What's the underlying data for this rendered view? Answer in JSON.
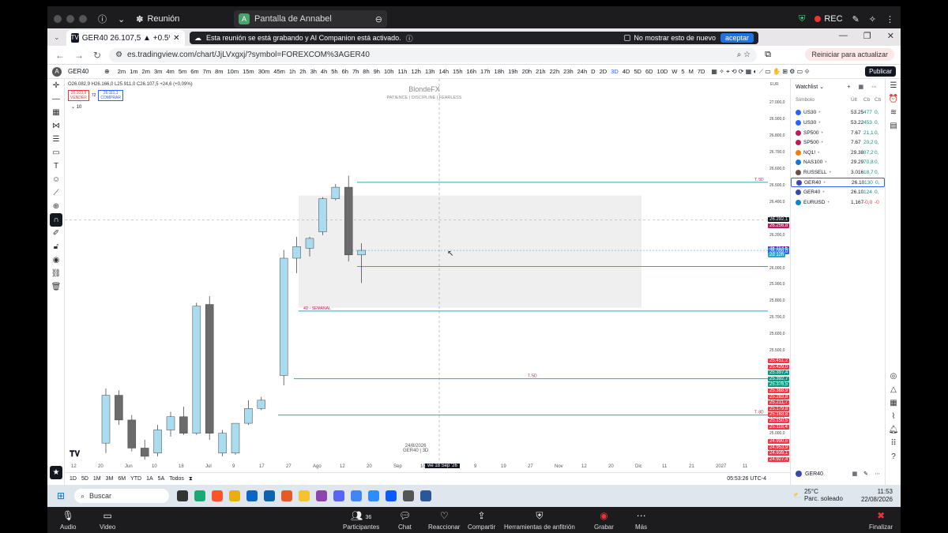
{
  "zoom_top": {
    "meeting_label": "Reunión",
    "share_label": "Pantalla de Annabel",
    "share_avatar": "A",
    "rec_label": "REC"
  },
  "browser": {
    "tab_title": "GER40 26.107,5 ▲ +0.5% Anna...",
    "new_tab": "+",
    "url": "es.tradingview.com/chart/JjLVxgxj/?symbol=FOREXCOM%3AGER40",
    "restart_label": "Reiniciar para actualizar",
    "avatar": "A",
    "win_min": "—",
    "win_max": "❐",
    "win_close": "✕"
  },
  "banner": {
    "text": "Esta reunión se está grabando y AI Companion está activado.",
    "checkbox_label": "No mostrar esto de nuevo",
    "accept_label": "aceptar"
  },
  "tv_top": {
    "symbol": "GER40",
    "timeframes": [
      "2m",
      "1m",
      "2m",
      "3m",
      "4m",
      "5m",
      "6m",
      "7m",
      "8m",
      "10m",
      "15m",
      "30m",
      "45m",
      "1h",
      "2h",
      "3h",
      "4h",
      "5h",
      "6h",
      "7h",
      "8h",
      "9h",
      "10h",
      "11h",
      "12h",
      "13h",
      "14h",
      "15h",
      "16h",
      "17h",
      "18h",
      "19h",
      "20h",
      "21h",
      "22h",
      "23h",
      "24h",
      "D",
      "2D",
      "3D",
      "4D",
      "5D",
      "6D",
      "10D",
      "W",
      "5",
      "M",
      "7D"
    ],
    "active_tf": "3D",
    "publish_label": "Publicar"
  },
  "chart_header": {
    "ohlc": "O26.082,9 H26.166,0 L25.911,0 C26.107,5 +24,6 (+0,09%)",
    "sell_price": "26.103,9",
    "sell_label": "VENDER",
    "spread": "72",
    "buy_price": "26.111,1",
    "buy_label": "COMPRAR",
    "volume_label": "10",
    "watermark_title": "BlondeFX",
    "watermark_sub": "PATIENCE  |  DISCIPLINE  |  FEARLESS",
    "footer_date": "24/8/2026",
    "footer_symbol": "GER40 | 3D"
  },
  "chart_data": {
    "type": "candlestick",
    "title": "",
    "x_ticks": [
      "12",
      "20",
      "Jun",
      "10",
      "18",
      "Jul",
      "9",
      "17",
      "27",
      "Ago",
      "12",
      "20",
      "Sep",
      "10",
      "Oct",
      "9",
      "19",
      "27",
      "Nov",
      "12",
      "20",
      "Dic",
      "11",
      "21",
      "2027",
      "11"
    ],
    "crosshair_x_label": "vie 18 Sep '26",
    "y_ticks": [
      "27.000,0",
      "26.900,0",
      "26.800,0",
      "26.700,0",
      "26.600,0",
      "26.500,0",
      "26.400,0",
      "26.300,0",
      "26.200,0",
      "26.100,0",
      "26.000,0",
      "25.900,0",
      "25.800,0",
      "25.700,0",
      "25.600,0",
      "25.500,0",
      "25.400,0",
      "25.300,0",
      "25.200,0",
      "25.100,0",
      "25.000,0",
      "24.900,0"
    ],
    "y_unit": "EUR",
    "ylim": [
      24850,
      27050
    ],
    "candles": [
      {
        "o": 24940,
        "h": 25270,
        "l": 24880,
        "c": 25230
      },
      {
        "o": 25230,
        "h": 25260,
        "l": 25050,
        "c": 25080
      },
      {
        "o": 25080,
        "h": 25110,
        "l": 24890,
        "c": 24910
      },
      {
        "o": 24910,
        "h": 24960,
        "l": 24840,
        "c": 24860
      },
      {
        "o": 24880,
        "h": 25050,
        "l": 24860,
        "c": 25020
      },
      {
        "o": 25020,
        "h": 25130,
        "l": 24980,
        "c": 25100
      },
      {
        "o": 25100,
        "h": 25160,
        "l": 24990,
        "c": 25000
      },
      {
        "o": 25000,
        "h": 25790,
        "l": 24990,
        "c": 25770
      },
      {
        "o": 25780,
        "h": 25830,
        "l": 24960,
        "c": 25000
      },
      {
        "o": 24880,
        "h": 25020,
        "l": 24860,
        "c": 25000
      },
      {
        "o": 24880,
        "h": 25060,
        "l": 24870,
        "c": 25060
      },
      {
        "o": 25060,
        "h": 25200,
        "l": 25050,
        "c": 25150
      },
      {
        "o": 25150,
        "h": 25220,
        "l": 25140,
        "c": 25200
      },
      {
        "o": 25350,
        "h": 26110,
        "l": 25290,
        "c": 26060
      },
      {
        "o": 26060,
        "h": 26190,
        "l": 25970,
        "c": 26130
      },
      {
        "o": 26120,
        "h": 26190,
        "l": 26070,
        "c": 26180
      },
      {
        "o": 26220,
        "h": 26430,
        "l": 26200,
        "c": 26420
      },
      {
        "o": 26420,
        "h": 26510,
        "l": 26410,
        "c": 26490
      },
      {
        "o": 26490,
        "h": 26560,
        "l": 26040,
        "c": 26080
      },
      {
        "o": 26080,
        "h": 26150,
        "l": 25910,
        "c": 26107.5
      }
    ],
    "levels": [
      {
        "price": 26520,
        "label": "T. 5D"
      },
      {
        "price": 26010,
        "label": ""
      },
      {
        "price": 25740,
        "label": "4D - SEMANAL"
      },
      {
        "price": 25330,
        "label": "T. 5D"
      },
      {
        "price": 25110,
        "label": "T. 8D"
      }
    ],
    "last_price": "26.107,5",
    "countdown": "2d 12h"
  },
  "price_labels": {
    "crosshair": "26.292,1",
    "p1": "26.256,8",
    "p2": "26.117,5",
    "p3": "26.107,5",
    "p4": "26.099,0",
    "red_stack": [
      "25.451,2",
      "25.429,0",
      "25.397,4",
      "25.392,7",
      "25.376,5",
      "25.368,9",
      "25.283,8",
      "25.211,7",
      "25.179,8",
      "25.163,8",
      "25.150,5",
      "25.118,4"
    ],
    "lower_stack": [
      "24.990,6",
      "24.953,9",
      "24.939,1",
      "24.927,4"
    ]
  },
  "bottom_bar": {
    "ranges": [
      "1D",
      "5D",
      "1M",
      "3M",
      "6M",
      "YTD",
      "1A",
      "5A",
      "Todos"
    ],
    "time": "05:53:26 UTC-4"
  },
  "watchlist": {
    "title": "Watchlist",
    "col_symbol": "Símbolo",
    "col_last": "Últ",
    "col_chg": "Cb",
    "col_pct": "Cb",
    "items": [
      {
        "sym": "US30",
        "last": "53.25",
        "chg": "477",
        "pct": "0,",
        "dir": "pos",
        "color": "#2962ff"
      },
      {
        "sym": "US30",
        "last": "53.22",
        "chg": "453",
        "pct": "0,",
        "dir": "pos",
        "color": "#2962ff"
      },
      {
        "sym": "SP500",
        "last": "7.67",
        "chg": "21,1",
        "pct": "0,",
        "dir": "pos",
        "color": "#c2185b"
      },
      {
        "sym": "SP500",
        "last": "7.67",
        "chg": "20,2",
        "pct": "0,",
        "dir": "pos",
        "color": "#c2185b"
      },
      {
        "sym": "NQ1!",
        "last": "29.38",
        "chg": "87,2",
        "pct": "0,",
        "dir": "pos",
        "color": "#f57c00"
      },
      {
        "sym": "NAS100",
        "last": "29.29",
        "chg": "70,8",
        "pct": "0,",
        "dir": "pos",
        "color": "#1976d2"
      },
      {
        "sym": "RUSSELL",
        "last": "3.016",
        "chg": "18,7",
        "pct": "0,",
        "dir": "pos",
        "color": "#6d4c41"
      },
      {
        "sym": "GER40",
        "last": "26.10",
        "chg": "130",
        "pct": "0,",
        "dir": "pos",
        "color": "#3949ab",
        "selected": true
      },
      {
        "sym": "GER40",
        "last": "26.10",
        "chg": "124",
        "pct": "0,",
        "dir": "pos",
        "color": "#3949ab"
      },
      {
        "sym": "EURUSD",
        "last": "1,167",
        "chg": "-0,0",
        "pct": "-0",
        "dir": "neg",
        "color": "#0288d1"
      }
    ],
    "bottom_symbol": "GER40"
  },
  "taskbar": {
    "search_label": "Buscar",
    "temp": "25°C",
    "weather": "Parc. soleado",
    "time": "11:53",
    "date": "22/08/2026"
  },
  "zoom_bottom": {
    "audio": "Audio",
    "video": "Video",
    "participants": "Participantes",
    "participant_count": "36",
    "chat": "Chat",
    "react": "Reaccionar",
    "share": "Compartir",
    "host_tools": "Herramientas de anfitrión",
    "record": "Grabar",
    "more": "Más",
    "end": "Finalizar"
  },
  "colors": {
    "bull": "#a9dcef",
    "bear": "#6b6b6b",
    "level": "#26a9c4",
    "accent": "#2962ff",
    "down_label": "#f23645"
  }
}
